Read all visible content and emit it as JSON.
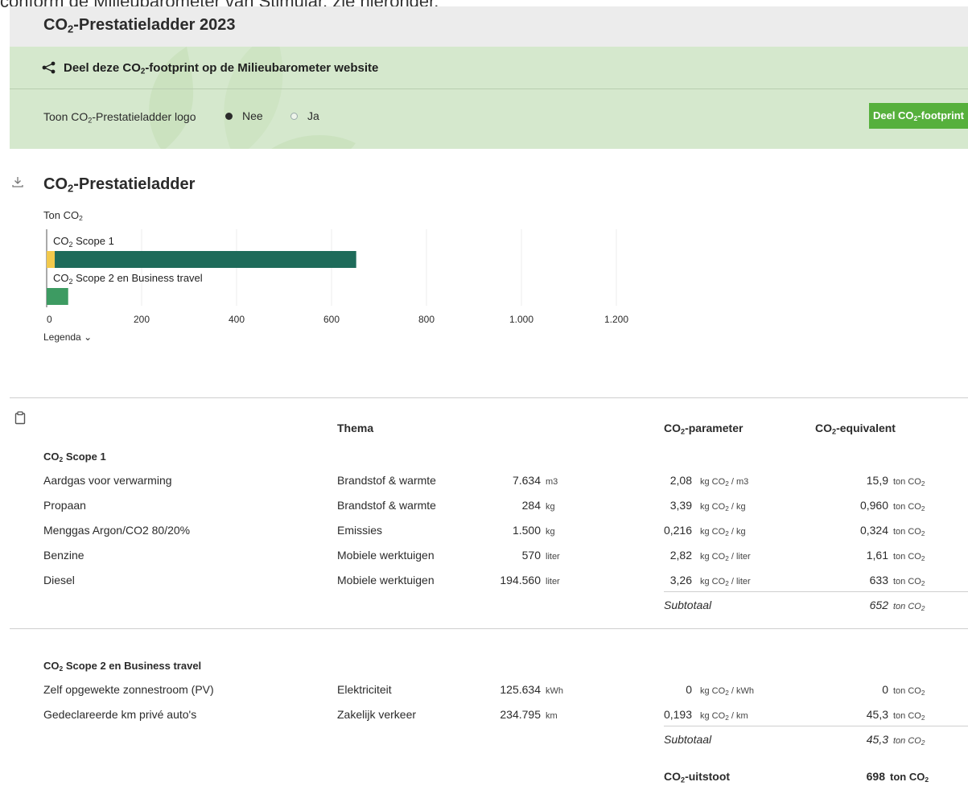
{
  "top_cut_text": "conform de Milieubarometer van Stimular, zie hieronder.",
  "header": {
    "title_pre": "CO",
    "title_sub": "2",
    "title_post": "-Prestatieladder 2023"
  },
  "share": {
    "title_pre": "Deel deze CO",
    "title_sub": "2",
    "title_post": "-footprint op de Milieubarometer website",
    "logo_label_pre": "Toon CO",
    "logo_label_sub": "2",
    "logo_label_post": "-Prestatieladder logo",
    "options": [
      "Nee",
      "Ja"
    ],
    "selected": "Nee",
    "button_pre": "Deel CO",
    "button_sub": "2",
    "button_post": "-footprint",
    "button_color": "#56b03c"
  },
  "chart_section": {
    "title_pre": "CO",
    "title_sub": "2",
    "title_post": "-Prestatieladder",
    "unit_pre": "Ton CO",
    "unit_sub": "2",
    "legend_label": "Legenda"
  },
  "chart_data": {
    "type": "bar",
    "orientation": "horizontal",
    "stacked": true,
    "categories": [
      "Scope 1",
      "Scope 2 en Business travel"
    ],
    "category_labels": [
      {
        "pre": "CO",
        "sub": "2",
        "post": " Scope 1"
      },
      {
        "pre": "CO",
        "sub": "2",
        "post": " Scope 2 en Business travel"
      }
    ],
    "series": [
      {
        "color": "#f2c94c",
        "values": [
          17,
          0
        ]
      },
      {
        "color": "#1e6b5a",
        "values": [
          635,
          0
        ]
      },
      {
        "color": "#3d9b62",
        "values": [
          0,
          45.3
        ]
      }
    ],
    "xlim": [
      0,
      1200
    ],
    "xticks": [
      0,
      200,
      400,
      600,
      800,
      1000,
      1200
    ],
    "xtick_labels": [
      "0",
      "200",
      "400",
      "600",
      "800",
      "1.000",
      "1.200"
    ],
    "grid": true,
    "ylabel_pre": "Ton CO",
    "ylabel_sub": "2"
  },
  "table": {
    "headers": {
      "thema": "Thema",
      "param_pre": "CO",
      "param_sub": "2",
      "param_post": "-parameter",
      "equiv_pre": "CO",
      "equiv_sub": "2",
      "equiv_post": "-equivalent"
    },
    "groups": [
      {
        "title_pre": "CO",
        "title_sub": "2",
        "title_post": " Scope 1",
        "rows": [
          {
            "name": "Aardgas voor verwarming",
            "thema": "Brandstof & warmte",
            "amount": "7.634",
            "unit": "m3",
            "param": "2,08",
            "param_unit": "m3",
            "equiv": "15,9"
          },
          {
            "name": "Propaan",
            "thema": "Brandstof & warmte",
            "amount": "284",
            "unit": "kg",
            "param": "3,39",
            "param_unit": "kg",
            "equiv": "0,960"
          },
          {
            "name": "Menggas Argon/CO2 80/20%",
            "thema": "Emissies",
            "amount": "1.500",
            "unit": "kg",
            "param": "0,216",
            "param_unit": "kg",
            "equiv": "0,324"
          },
          {
            "name": "Benzine",
            "thema": "Mobiele werktuigen",
            "amount": "570",
            "unit": "liter",
            "param": "2,82",
            "param_unit": "liter",
            "equiv": "1,61"
          },
          {
            "name": "Diesel",
            "thema": "Mobiele werktuigen",
            "amount": "194.560",
            "unit": "liter",
            "param": "3,26",
            "param_unit": "liter",
            "equiv": "633"
          }
        ],
        "subtotal_label": "Subtotaal",
        "subtotal": "652"
      },
      {
        "title_pre": "CO",
        "title_sub": "2",
        "title_post": " Scope 2 en Business travel",
        "rows": [
          {
            "name": "Zelf opgewekte zonnestroom (PV)",
            "thema": "Elektriciteit",
            "amount": "125.634",
            "unit": "kWh",
            "param": "0",
            "param_unit": "kWh",
            "equiv": "0"
          },
          {
            "name": "Gedeclareerde km privé auto's",
            "thema": "Zakelijk verkeer",
            "amount": "234.795",
            "unit": "km",
            "param": "0,193",
            "param_unit": "km",
            "equiv": "45,3"
          }
        ],
        "subtotal_label": "Subtotaal",
        "subtotal": "45,3"
      }
    ],
    "total": {
      "label_pre": "CO",
      "label_sub": "2",
      "label_post": "-uitstoot",
      "value": "698",
      "unit_pre": "ton CO",
      "unit_sub": "2"
    },
    "unit_ton_pre": "ton CO",
    "unit_ton_sub": "2",
    "unit_kg_pre": "kg CO",
    "unit_kg_sub": "2",
    "unit_kg_sep": " / "
  }
}
